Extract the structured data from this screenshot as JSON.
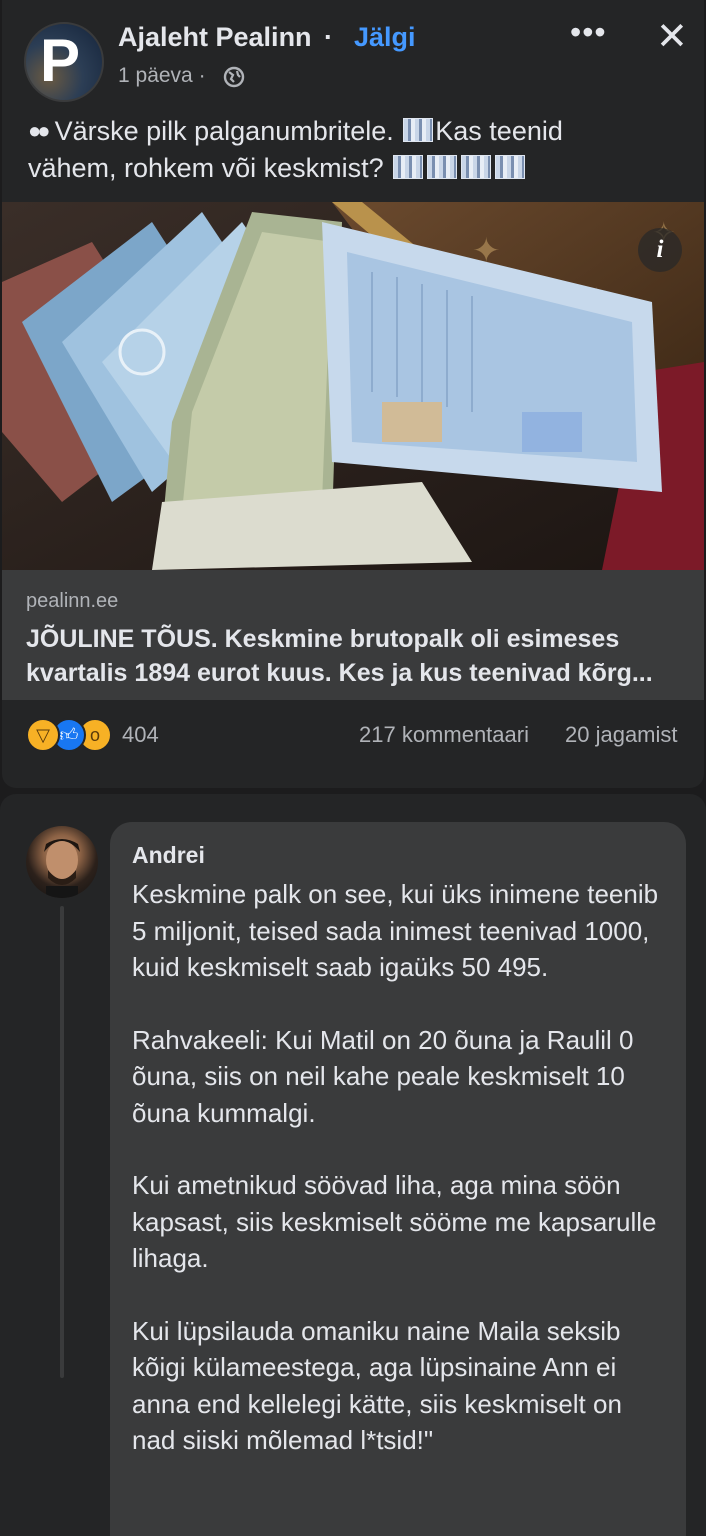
{
  "post": {
    "page_name": "Ajaleht Pealinn",
    "separator": "·",
    "follow_label": "Jälgi",
    "timestamp": "1 päeva ·",
    "more_icon": "more-options-icon",
    "close_icon": "close-icon",
    "text_line1": "Värske pilk palganumbritele.",
    "text_line1b": "Kas teenid",
    "text_line2": "vähem, rohkem või keskmist?",
    "link": {
      "domain": "pealinn.ee",
      "title": "JÕULINE TÕUS. Keskmine brutopalk oli esimeses kvartalis 1894 eurot kuus. Kes ja kus teenivad kõrg..."
    },
    "stats": {
      "reaction_count": "404",
      "comments": "217 kommentaari",
      "shares": "20 jagamist"
    }
  },
  "comment": {
    "author": "Andrei",
    "paragraphs": [
      "Keskmine palk on see, kui üks inimene teenib 5 miljonit, teised sada inimest teenivad 1000, kuid keskmiselt saab igaüks 50 495.",
      "Rahvakeeli: Kui Matil on 20 õuna ja Raulil 0 õuna, siis on neil kahe peale keskmiselt 10 õuna kummalgi.",
      "Kui ametnikud söövad liha, aga mina söön kapsast, siis keskmiselt sööme me kapsarulle lihaga.",
      "Kui lüpsilauda omaniku naine Maila seksib kõigi külameestega, aga lüpsinaine Ann ei anna end kellelegi kätte, siis keskmiselt on nad siiski mõlemad l*tsid!\""
    ]
  }
}
